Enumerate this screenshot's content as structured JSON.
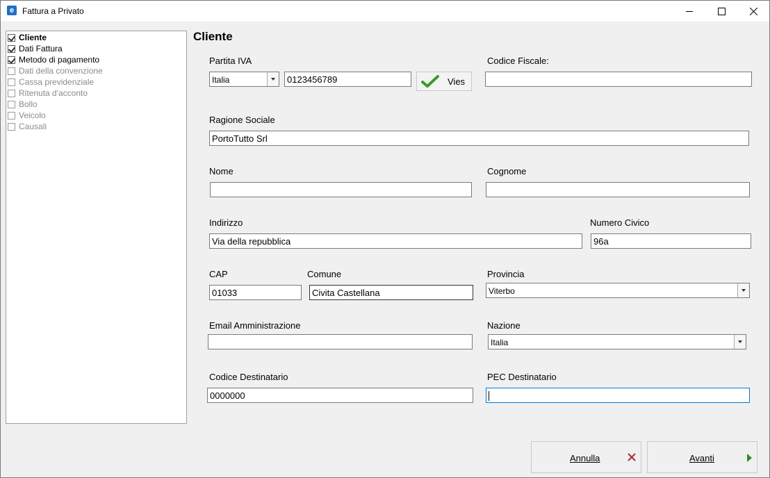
{
  "window": {
    "title": "Fattura a Privato"
  },
  "tree": {
    "items": [
      {
        "label": "Cliente",
        "checked": true,
        "enabled": true,
        "selected": true
      },
      {
        "label": "Dati Fattura",
        "checked": true,
        "enabled": true,
        "selected": false
      },
      {
        "label": "Metodo di pagamento",
        "checked": true,
        "enabled": true,
        "selected": false
      },
      {
        "label": "Dati della convenzione",
        "checked": false,
        "enabled": false,
        "selected": false
      },
      {
        "label": "Cassa previdenziale",
        "checked": false,
        "enabled": false,
        "selected": false
      },
      {
        "label": "Ritenuta d'acconto",
        "checked": false,
        "enabled": false,
        "selected": false
      },
      {
        "label": "Bollo",
        "checked": false,
        "enabled": false,
        "selected": false
      },
      {
        "label": "Veicolo",
        "checked": false,
        "enabled": false,
        "selected": false
      },
      {
        "label": "Causali",
        "checked": false,
        "enabled": false,
        "selected": false
      }
    ]
  },
  "form": {
    "section_title": "Cliente",
    "partita_iva": {
      "label": "Partita IVA",
      "country": "Italia",
      "value": "0123456789"
    },
    "vies_label": "Vies",
    "codice_fiscale": {
      "label": "Codice Fiscale:",
      "value": ""
    },
    "ragione_sociale": {
      "label": "Ragione Sociale",
      "value": "PortoTutto Srl"
    },
    "nome": {
      "label": "Nome",
      "value": ""
    },
    "cognome": {
      "label": "Cognome",
      "value": ""
    },
    "indirizzo": {
      "label": "Indirizzo",
      "value": "Via della repubblica"
    },
    "numero_civico": {
      "label": "Numero Civico",
      "value": "96a"
    },
    "cap": {
      "label": "CAP",
      "value": "01033"
    },
    "comune": {
      "label": "Comune",
      "value": "Civita Castellana"
    },
    "provincia": {
      "label": "Provincia",
      "value": "Viterbo"
    },
    "email": {
      "label": "Email Amministrazione",
      "value": ""
    },
    "nazione": {
      "label": "Nazione",
      "value": "Italia"
    },
    "codice_destinatario": {
      "label": "Codice Destinatario",
      "value": "0000000"
    },
    "pec": {
      "label": "PEC Destinatario",
      "value": ""
    }
  },
  "buttons": {
    "annulla": "Annulla",
    "avanti": "Avanti"
  },
  "colors": {
    "accent_focus": "#0078d7",
    "check_green": "#3a9a2a",
    "cancel_red": "#b03030"
  }
}
